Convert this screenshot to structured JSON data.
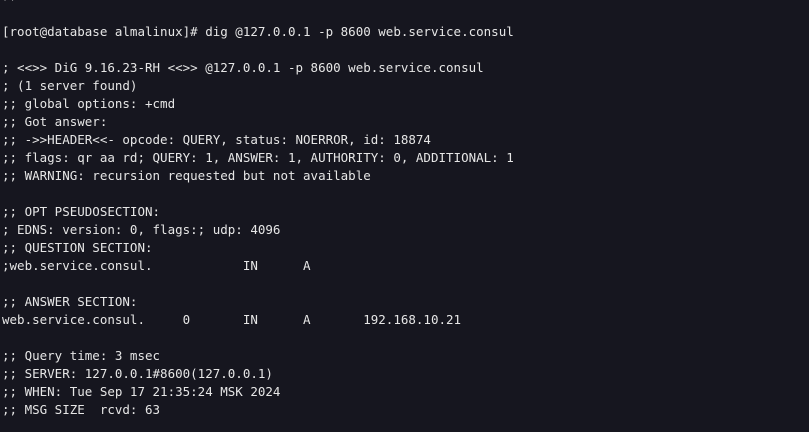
{
  "terminal": {
    "top_fragment": ";;",
    "lines": [
      "[root@database almalinux]# dig @127.0.0.1 -p 8600 web.service.consul",
      "",
      "; <<>> DiG 9.16.23-RH <<>> @127.0.0.1 -p 8600 web.service.consul",
      "; (1 server found)",
      ";; global options: +cmd",
      ";; Got answer:",
      ";; ->>HEADER<<- opcode: QUERY, status: NOERROR, id: 18874",
      ";; flags: qr aa rd; QUERY: 1, ANSWER: 1, AUTHORITY: 0, ADDITIONAL: 1",
      ";; WARNING: recursion requested but not available",
      "",
      ";; OPT PSEUDOSECTION:",
      "; EDNS: version: 0, flags:; udp: 4096",
      ";; QUESTION SECTION:",
      ";web.service.consul.            IN      A",
      "",
      ";; ANSWER SECTION:",
      "web.service.consul.     0       IN      A       192.168.10.21",
      "",
      ";; Query time: 3 msec",
      ";; SERVER: 127.0.0.1#8600(127.0.0.1)",
      ";; WHEN: Tue Sep 17 21:35:24 MSK 2024",
      ";; MSG SIZE  rcvd: 63"
    ]
  }
}
